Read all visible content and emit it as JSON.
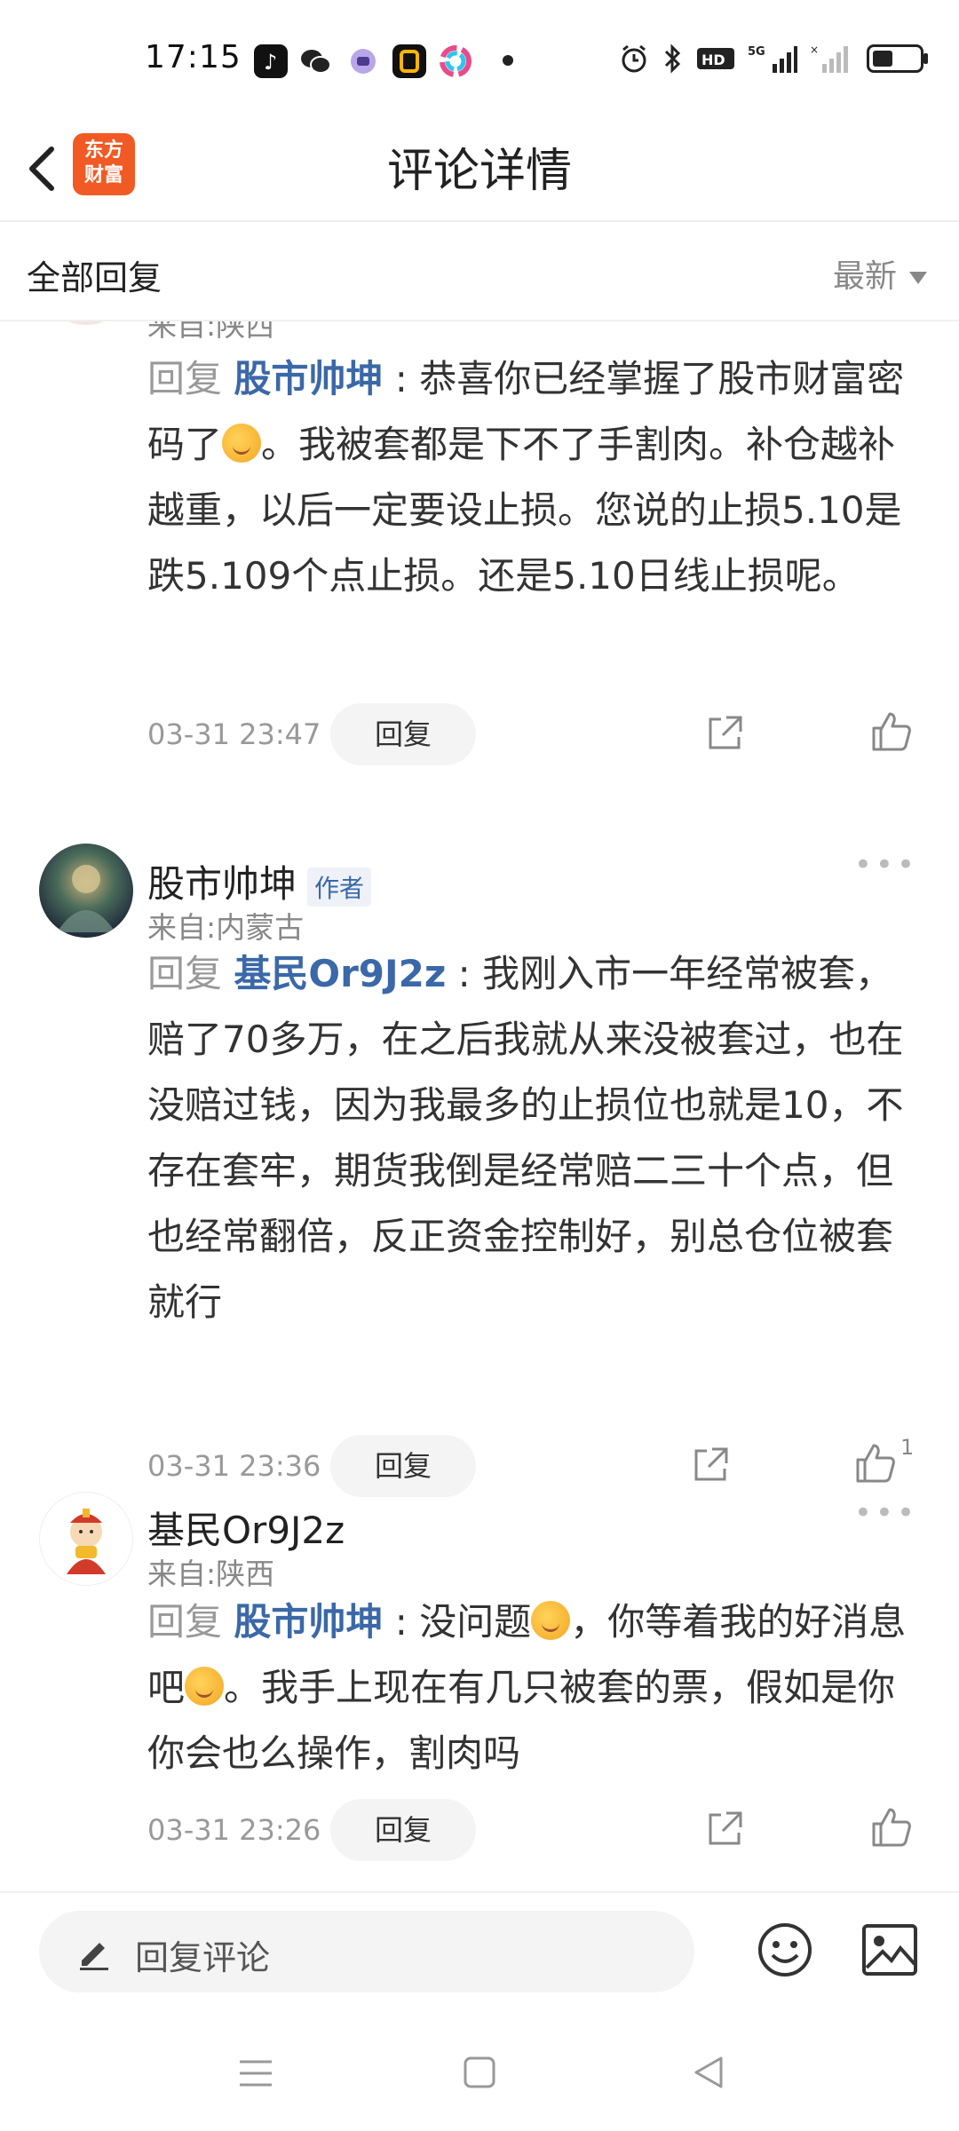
{
  "status_bar": {
    "time": "17:15",
    "icons": [
      "tiktok-icon",
      "wechat-icon",
      "app-icon",
      "app-icon",
      "app-icon",
      "dot",
      "alarm-icon",
      "bluetooth-icon",
      "hd-icon",
      "5g-signal-icon",
      "signal-icon",
      "battery-icon"
    ]
  },
  "header": {
    "back_icon": "chevron-left-icon",
    "logo_line1": "东方",
    "logo_line2": "财富",
    "title": "评论详情"
  },
  "filter": {
    "title": "全部回复",
    "sort_label": "最新"
  },
  "comments": [
    {
      "from": "来自:陕西",
      "reply_kw": "回复",
      "mention": "股市帅坤",
      "colon": " : ",
      "text_parts": [
        "恭喜你已经掌握了股市财富密码了",
        "。我被套都是下不了手割肉。补仓越补越重，以后一定要设止损。您说的止损5.10是跌5.109个点止损。还是5.10日线止损呢。"
      ],
      "date": "03-31 23:47",
      "reply_btn": "回复"
    },
    {
      "user": "股市帅坤",
      "badge": "作者",
      "from": "来自:内蒙古",
      "reply_kw": "回复",
      "mention": "基民Or9J2z",
      "colon": " : ",
      "text": "我刚入市一年经常被套，赔了70多万，在之后我就从来没被套过，也在没赔过钱，因为我最多的止损位也就是10，不存在套牢，期货我倒是经常赔二三十个点，但也经常翻倍，反正资金控制好，别总仓位被套就行",
      "date": "03-31 23:36",
      "reply_btn": "回复",
      "like_count": "1"
    },
    {
      "user": "基民Or9J2z",
      "from": "来自:陕西",
      "reply_kw": "回复",
      "mention": "股市帅坤",
      "colon": " : ",
      "text_parts": [
        "没问题",
        "，你等着我的好消息吧",
        "。我手上现在有几只被套的票，假如是你你会也么操作，割肉吗"
      ],
      "date": "03-31 23:26",
      "reply_btn": "回复"
    }
  ],
  "bottom": {
    "input_placeholder": "回复评论"
  }
}
